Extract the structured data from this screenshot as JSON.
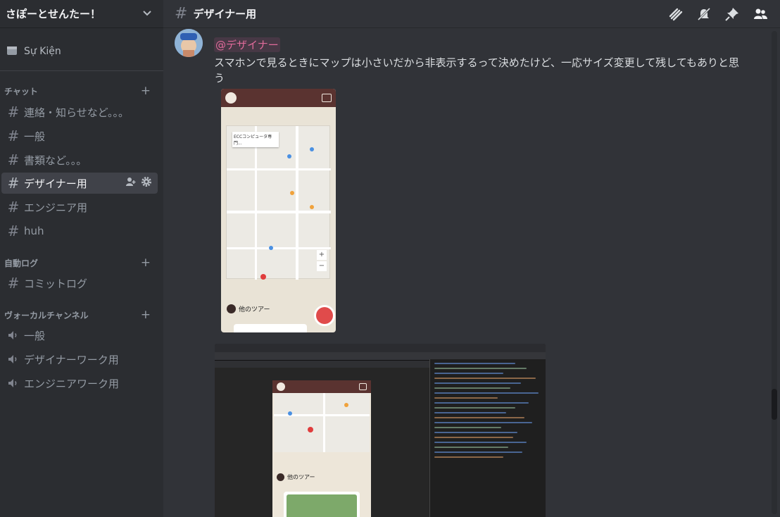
{
  "server": {
    "name": "さぽーとせんたー！"
  },
  "events": {
    "label": "Sự Kiện"
  },
  "categories": [
    {
      "name": "チャット"
    },
    {
      "name": "自動ログ"
    },
    {
      "name": "ヴォーカルチャンネル"
    }
  ],
  "text_channels": [
    {
      "label": "連絡・知らせなど。。。"
    },
    {
      "label": "一般"
    },
    {
      "label": "書類など。。。"
    },
    {
      "label": "デザイナー用"
    },
    {
      "label": "エンジニア用"
    },
    {
      "label": "huh"
    }
  ],
  "log_channels": [
    {
      "label": "コミットログ"
    }
  ],
  "voice_channels": [
    {
      "label": "一般"
    },
    {
      "label": "デザイナーワーク用"
    },
    {
      "label": "エンジニアワーク用"
    }
  ],
  "header": {
    "channel_title": "デザイナー用"
  },
  "message": {
    "mention": "@デザイナー",
    "text": "スマホンで見るときにマップは小さいだから非表示するって決めたけど、一応サイズ変更して残してもありと思う"
  },
  "attachment_phone": {
    "map_card_title": "ECCコンピュータ専門...",
    "tour_heading": "他のツアー"
  },
  "attachment_devtools": {
    "tour_heading": "他のツアー"
  },
  "icons": {
    "threads": "threads-icon",
    "mute": "bell-off-icon",
    "pin": "pin-icon",
    "members": "members-icon"
  },
  "colors": {
    "accent": "#5865f2",
    "mention": "#e06b9b",
    "background": "#313338",
    "sidebar": "#2b2d31"
  }
}
